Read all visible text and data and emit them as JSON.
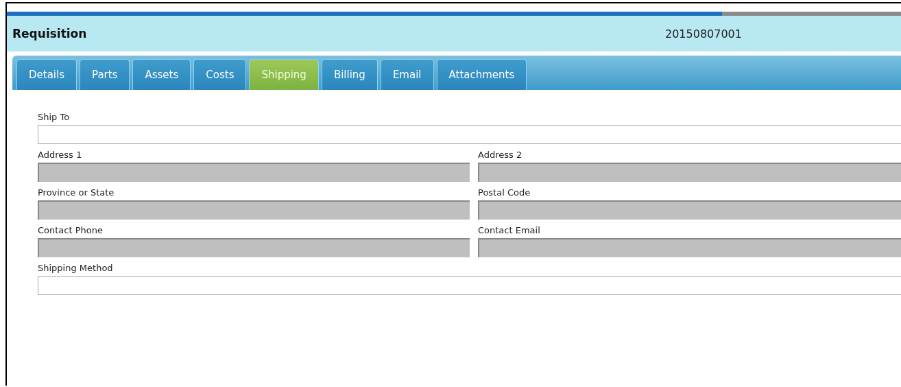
{
  "progress": {
    "level": 0.8
  },
  "header": {
    "title": "Requisition",
    "number": "20150807001"
  },
  "tabs": [
    {
      "label": "Details",
      "selected": false
    },
    {
      "label": "Parts",
      "selected": false
    },
    {
      "label": "Assets",
      "selected": false
    },
    {
      "label": "Costs",
      "selected": false
    },
    {
      "label": "Shipping",
      "selected": true
    },
    {
      "label": "Billing",
      "selected": false
    },
    {
      "label": "Email",
      "selected": false
    },
    {
      "label": "Attachments",
      "selected": false
    }
  ],
  "rows": [
    [
      {
        "label": "Ship To",
        "disabled": false,
        "kind": "full"
      }
    ],
    [
      {
        "label": "Address 1",
        "disabled": true,
        "kind": "half"
      },
      {
        "label": "Address 2",
        "disabled": true,
        "kind": "half"
      }
    ],
    [
      {
        "label": "Province or State",
        "disabled": true,
        "kind": "half"
      },
      {
        "label": "Postal Code",
        "disabled": true,
        "kind": "half"
      }
    ],
    [
      {
        "label": "Contact Phone",
        "disabled": true,
        "kind": "half"
      },
      {
        "label": "Contact Email",
        "disabled": true,
        "kind": "half"
      }
    ],
    [
      {
        "label": "Shipping Method",
        "disabled": false,
        "kind": "full"
      }
    ]
  ]
}
